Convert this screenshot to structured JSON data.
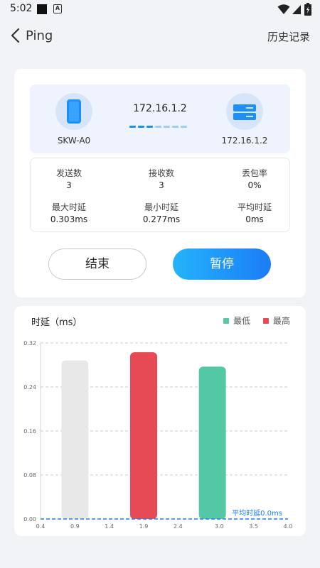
{
  "status_bar": {
    "time": "5:02",
    "notif_letter": "A"
  },
  "app_bar": {
    "title": "Ping",
    "history_label": "历史记录"
  },
  "connection": {
    "source_device": "SKW-A0",
    "target_ip_top": "172.16.1.2",
    "target_device_ip": "172.16.1.2"
  },
  "stats": [
    {
      "label": "发送数",
      "value": "3"
    },
    {
      "label": "接收数",
      "value": "3"
    },
    {
      "label": "丢包率",
      "value": "0%"
    },
    {
      "label": "最大时延",
      "value": "0.303ms"
    },
    {
      "label": "最小时延",
      "value": "0.277ms"
    },
    {
      "label": "平均时延",
      "value": "0ms"
    }
  ],
  "buttons": {
    "end_label": "结束",
    "pause_label": "暂停"
  },
  "colors": {
    "accent": "#1b7cf6",
    "min": "#54c8a5",
    "max": "#e54a55",
    "neutral": "#e8e8e8"
  },
  "chart_data": {
    "type": "bar",
    "title": "时延（ms）",
    "legend": [
      {
        "name": "最低",
        "color": "#54c8a5"
      },
      {
        "name": "最高",
        "color": "#e54a55"
      }
    ],
    "legend_position": "top-right",
    "grid": true,
    "xlim": [
      0.4,
      4.0
    ],
    "ylim": [
      0,
      0.32
    ],
    "x_ticks": [
      "0.4",
      "0.9",
      "1.4",
      "1.9",
      "2.4",
      "3.0",
      "3.5",
      "4.0"
    ],
    "y_ticks": [
      "0.00",
      "0.08",
      "0.16",
      "0.24",
      "0.32"
    ],
    "bars": [
      {
        "x": 0.9,
        "value": 0.288,
        "color": "#e8e8e8"
      },
      {
        "x": 1.9,
        "value": 0.303,
        "color": "#e54a55"
      },
      {
        "x": 2.9,
        "value": 0.277,
        "color": "#54c8a5"
      }
    ],
    "average_line": {
      "value": 0.0,
      "label": "平均时延0.0ms",
      "color": "#1b7cf6"
    }
  }
}
